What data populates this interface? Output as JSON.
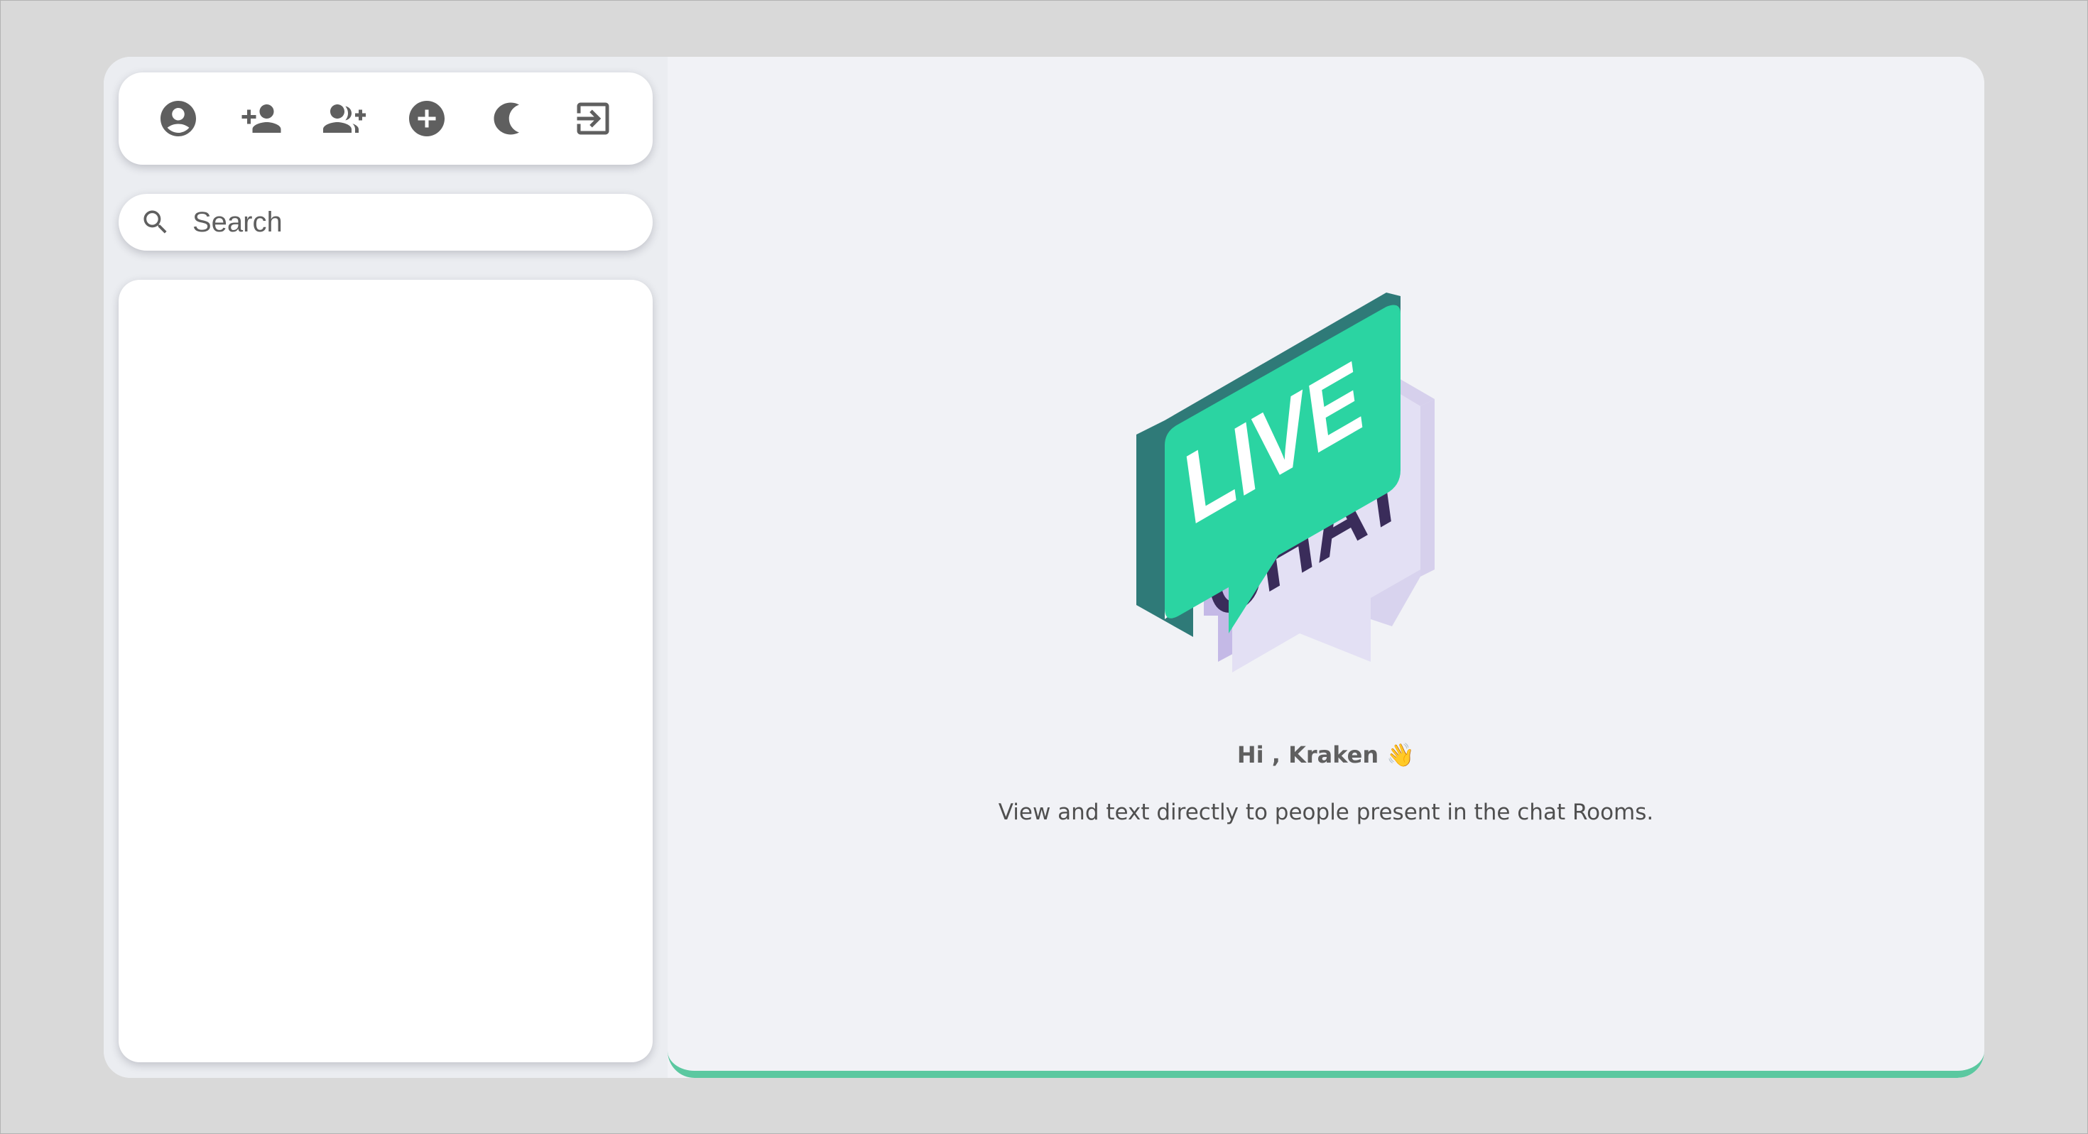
{
  "toolbar": {
    "buttons": [
      {
        "icon": "account-circle-icon"
      },
      {
        "icon": "add-person-icon"
      },
      {
        "icon": "add-group-icon"
      },
      {
        "icon": "add-circle-icon"
      },
      {
        "icon": "moon-icon"
      },
      {
        "icon": "logout-icon"
      }
    ]
  },
  "search": {
    "placeholder": "Search",
    "value": ""
  },
  "chat_list": {
    "items": []
  },
  "welcome": {
    "logo_text_top": "LIVE",
    "logo_text_bottom": "CHAT",
    "greeting": "Hi , Kraken 👋",
    "subtitle": "View and text directly to people present in the chat Rooms."
  },
  "colors": {
    "accent": "#5bc8a0",
    "logo_green": "#2bd4a2",
    "logo_dark_green": "#2f7a78",
    "logo_lavender": "#e2dff2",
    "logo_purple_text": "#3a2c5a",
    "icon_gray": "#5f5f5f",
    "background": "#d9d9d9"
  }
}
